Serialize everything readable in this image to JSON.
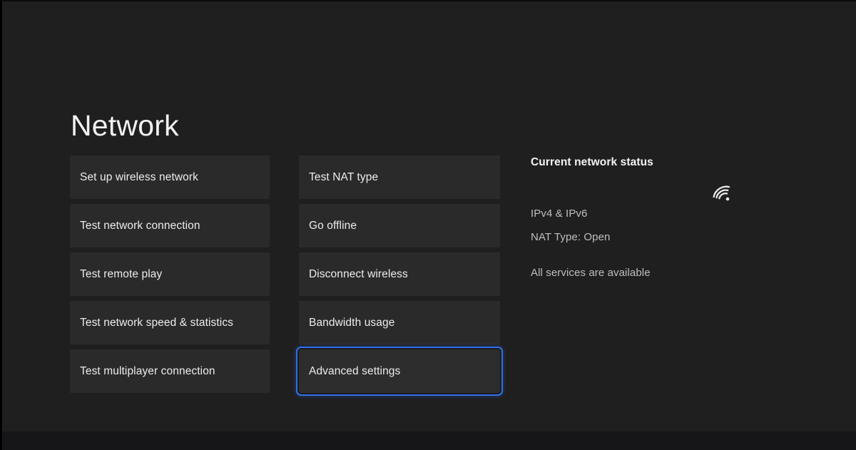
{
  "page": {
    "title": "Network",
    "background_color": "#1f1f1f",
    "tile_color": "#2a2a2a",
    "focus_color": "#2f6fe8"
  },
  "columns": {
    "left": [
      {
        "label": "Set up wireless network",
        "selected": false
      },
      {
        "label": "Test network connection",
        "selected": false
      },
      {
        "label": "Test remote play",
        "selected": false
      },
      {
        "label": "Test network speed & statistics",
        "selected": false
      },
      {
        "label": "Test multiplayer connection",
        "selected": false
      }
    ],
    "middle": [
      {
        "label": "Test NAT type",
        "selected": false
      },
      {
        "label": "Go offline",
        "selected": false
      },
      {
        "label": "Disconnect wireless",
        "selected": false
      },
      {
        "label": "Bandwidth usage",
        "selected": false
      },
      {
        "label": "Advanced settings",
        "selected": true
      }
    ]
  },
  "status": {
    "heading": "Current network status",
    "icon": "wifi-signal-icon",
    "ip_protocol": "IPv4 & IPv6",
    "nat_type": "NAT Type: Open",
    "services": "All services are available"
  }
}
